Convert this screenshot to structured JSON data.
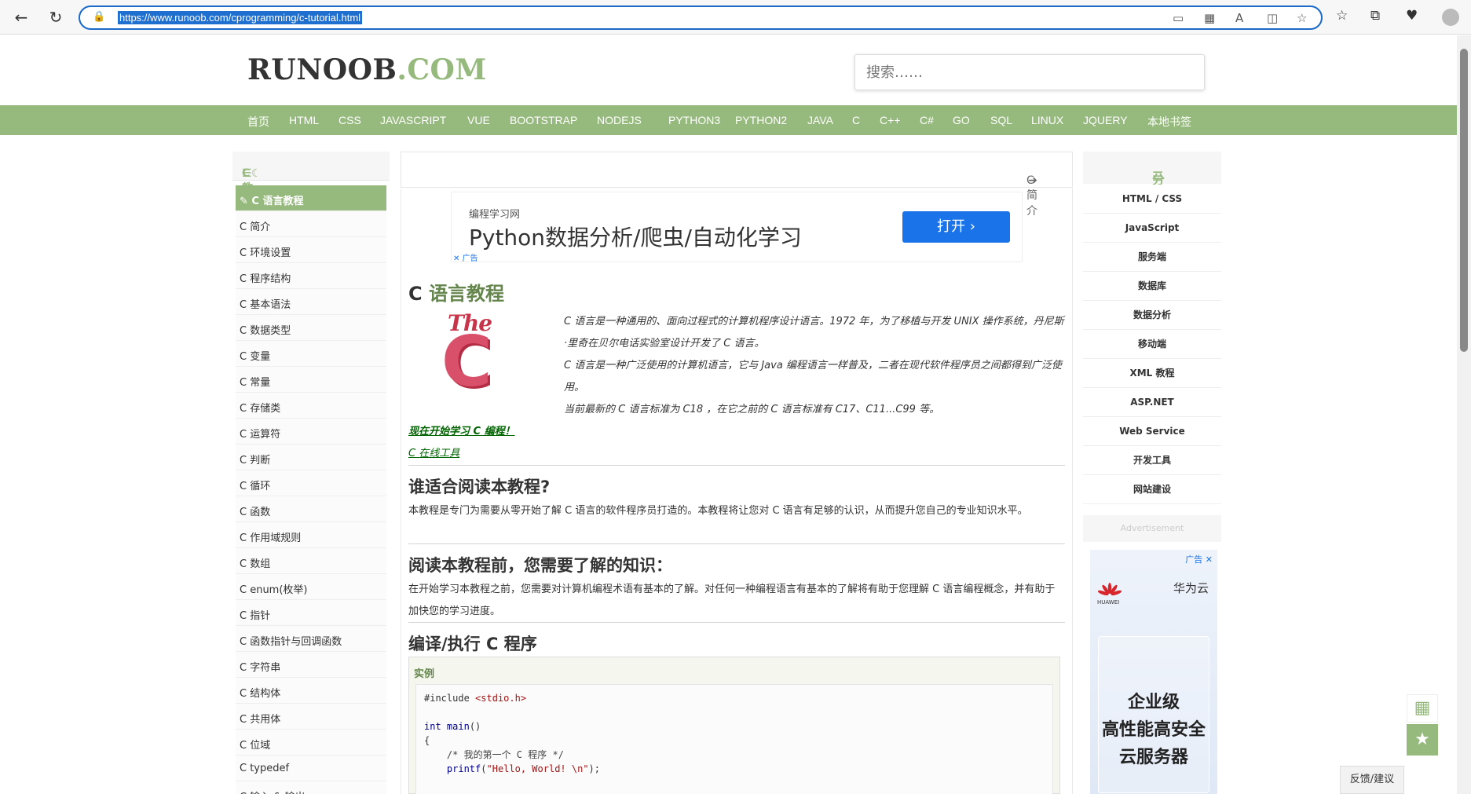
{
  "browser": {
    "url": "https://www.runoob.com/cprogramming/c-tutorial.html"
  },
  "header": {
    "logo_main": "RUNOOB",
    "logo_ext": ".COM",
    "search_placeholder": "搜索……"
  },
  "topnav": [
    "首页",
    "HTML",
    "CSS",
    "JAVASCRIPT",
    "VUE",
    "BOOTSTRAP",
    "NODEJS",
    "PYTHON3",
    "PYTHON2",
    "JAVA",
    "C",
    "C++",
    "C#",
    "GO",
    "SQL",
    "LINUX",
    "JQUERY",
    "本地书签"
  ],
  "sidebar": {
    "title": "C 教程",
    "items": [
      "C 语言教程",
      "C 简介",
      "C 环境设置",
      "C 程序结构",
      "C 基本语法",
      "C 数据类型",
      "C 变量",
      "C 常量",
      "C 存储类",
      "C 运算符",
      "C 判断",
      "C 循环",
      "C 函数",
      "C 作用域规则",
      "C 数组",
      "C enum(枚举)",
      "C 指针",
      "C 函数指针与回调函数",
      "C 字符串",
      "C 结构体",
      "C 共用体",
      "C 位域",
      "C typedef",
      "C 输入 & 输出"
    ]
  },
  "breadcrumb": {
    "next": "C 简介"
  },
  "ad": {
    "source": "编程学习网",
    "headline": "Python数据分析/爬虫/自动化学习",
    "button": "打开",
    "tag": "广告"
  },
  "content": {
    "title_prefix": "C",
    "title_rest": "语言教程",
    "logo_the": "The",
    "logo_c": "C",
    "intro": [
      "C 语言是一种通用的、面向过程式的计算机程序设计语言。1972 年，为了移植与开发 UNIX 操作系统，丹尼斯·里奇在贝尔电话实验室设计开发了 C 语言。",
      "C 语言是一种广泛使用的计算机语言，它与 Java 编程语言一样普及，二者在现代软件程序员之间都得到广泛使用。",
      "当前最新的 C 语言标准为 C18 ，在它之前的 C 语言标准有 C17、C11...C99 等。"
    ],
    "link_start": "现在开始学习 C 编程！",
    "link_online": "C 在线工具",
    "sections": [
      {
        "title": "谁适合阅读本教程?",
        "text": "本教程是专门为需要从零开始了解 C 语言的软件程序员打造的。本教程将让您对 C 语言有足够的认识，从而提升您自己的专业知识水平。"
      },
      {
        "title": "阅读本教程前，您需要了解的知识：",
        "text": "在开始学习本教程之前，您需要对计算机编程术语有基本的了解。对任何一种编程语言有基本的了解将有助于您理解 C 语言编程概念，并有助于加快您的学习进度。"
      },
      {
        "title": "编译/执行 C 程序",
        "text": ""
      }
    ],
    "example_label": "实例",
    "code": {
      "include": "#include ",
      "header": "<stdio.h>",
      "int": "int ",
      "main": "main",
      "parens": "()",
      "open": "{",
      "comment": "/* 我的第一个 C 程序 */",
      "printf": "printf",
      "str": "\"Hello, World! \\n\"",
      "end": ");"
    }
  },
  "right": {
    "title": "分类导航",
    "items": [
      "HTML / CSS",
      "JavaScript",
      "服务端",
      "数据库",
      "数据分析",
      "移动端",
      "XML 教程",
      "ASP.NET",
      "Web Service",
      "开发工具",
      "网站建设"
    ],
    "adv_label": "Advertisement",
    "huawei": {
      "tag": "广告 ✕",
      "brand": "HUAWEI",
      "name": "华为云",
      "slogan": [
        "企业级",
        "高性能高安全",
        "云服务器"
      ]
    }
  },
  "floating": {
    "feedback": "反馈/建议"
  },
  "colors": {
    "brand_green": "#96b97d",
    "title_green": "#64854c",
    "url_blue": "#1b6ac9"
  }
}
